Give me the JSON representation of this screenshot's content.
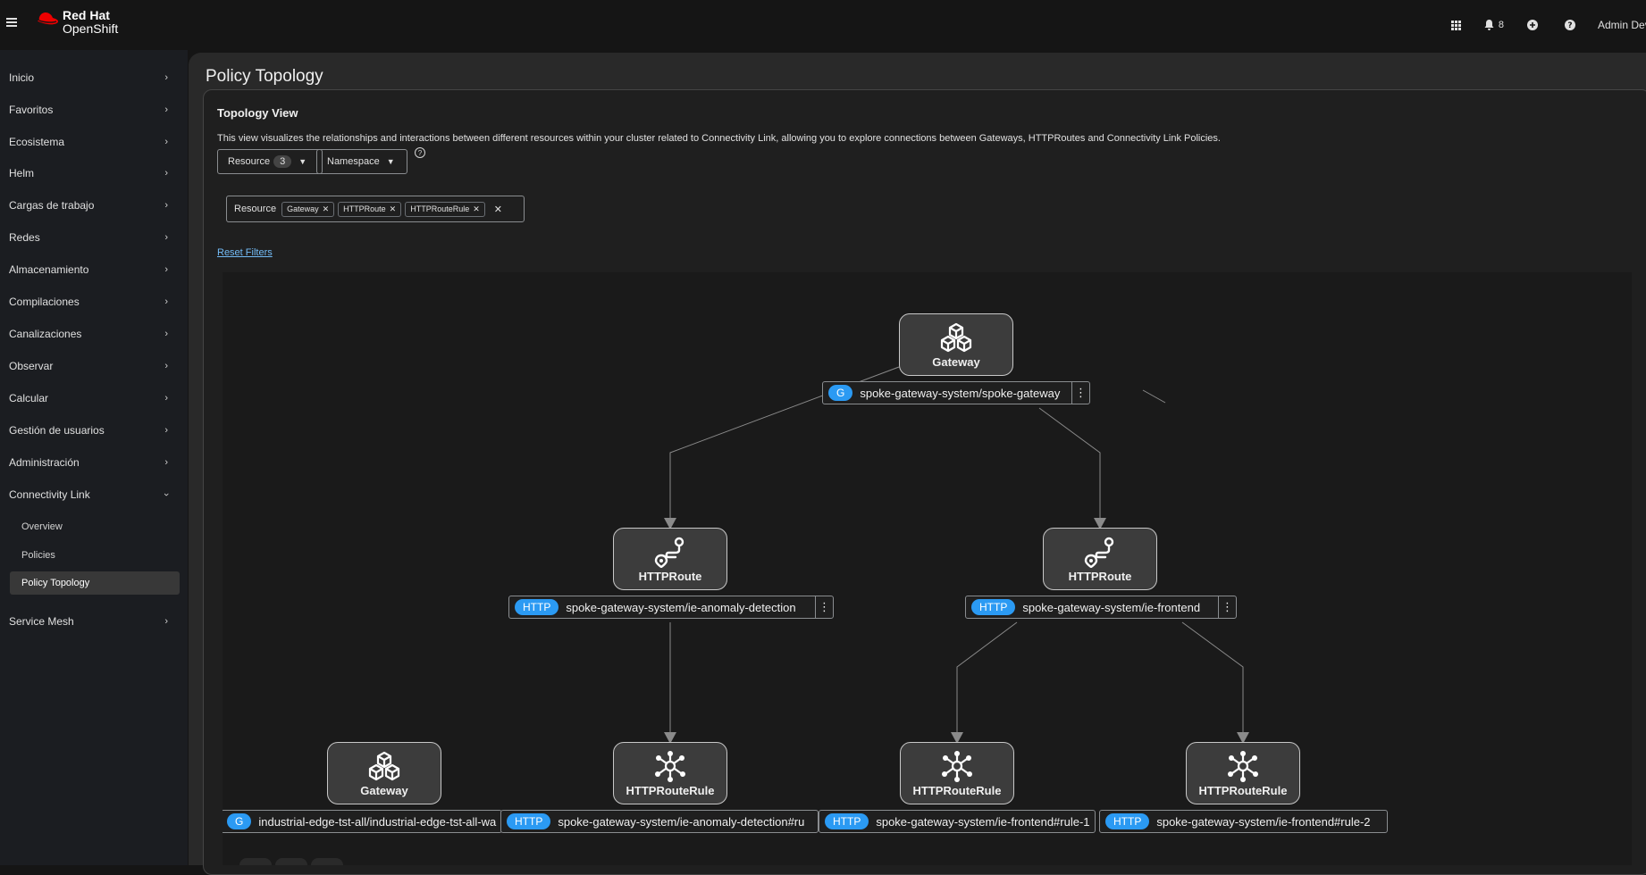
{
  "masthead": {
    "brand_line1": "Red Hat",
    "brand_line2": "OpenShift",
    "notifications_count": "8",
    "user": "Admin Dev"
  },
  "sidebar": {
    "items": [
      {
        "label": "Inicio"
      },
      {
        "label": "Favoritos"
      },
      {
        "label": "Ecosistema"
      },
      {
        "label": "Helm"
      },
      {
        "label": "Cargas de trabajo"
      },
      {
        "label": "Redes"
      },
      {
        "label": "Almacenamiento"
      },
      {
        "label": "Compilaciones"
      },
      {
        "label": "Canalizaciones"
      },
      {
        "label": "Observar"
      },
      {
        "label": "Calcular"
      },
      {
        "label": "Gestión de usuarios"
      },
      {
        "label": "Administración"
      },
      {
        "label": "Connectivity Link"
      },
      {
        "label": "Service Mesh"
      }
    ],
    "sub_items": [
      {
        "label": "Overview"
      },
      {
        "label": "Policies"
      },
      {
        "label": "Policy Topology"
      }
    ]
  },
  "page": {
    "title": "Policy Topology",
    "card_title": "Topology View",
    "description": "This view visualizes the relationships and interactions between different resources within your cluster related to Connectivity Link, allowing you to explore connections between Gateways, HTTPRoutes and Connectivity Link Policies.",
    "resource_dropdown": "Resource",
    "resource_count": "3",
    "namespace_dropdown": "Namespace",
    "chip_category": "Resource",
    "chips": [
      "Gateway",
      "HTTPRoute",
      "HTTPRouteRule"
    ],
    "reset_filters": "Reset Filters"
  },
  "topology": {
    "nodes": [
      {
        "type": "Gateway",
        "badge": "G",
        "label": "spoke-gateway-system/spoke-gateway"
      },
      {
        "type": "HTTPRoute",
        "badge": "HTTP",
        "label": "spoke-gateway-system/ie-anomaly-detection"
      },
      {
        "type": "HTTPRoute",
        "badge": "HTTP",
        "label": "spoke-gateway-system/ie-frontend"
      },
      {
        "type": "Gateway",
        "badge": "G",
        "label": "industrial-edge-tst-all/industrial-edge-tst-all-wa"
      },
      {
        "type": "HTTPRouteRule",
        "badge": "HTTP",
        "label": "spoke-gateway-system/ie-anomaly-detection#ru"
      },
      {
        "type": "HTTPRouteRule",
        "badge": "HTTP",
        "label": "spoke-gateway-system/ie-frontend#rule-1"
      },
      {
        "type": "HTTPRouteRule",
        "badge": "HTTP",
        "label": "spoke-gateway-system/ie-frontend#rule-2"
      }
    ]
  },
  "colors": {
    "badge": "#2b9af3",
    "link": "#73bcf7",
    "brand_red": "#ee0000"
  }
}
